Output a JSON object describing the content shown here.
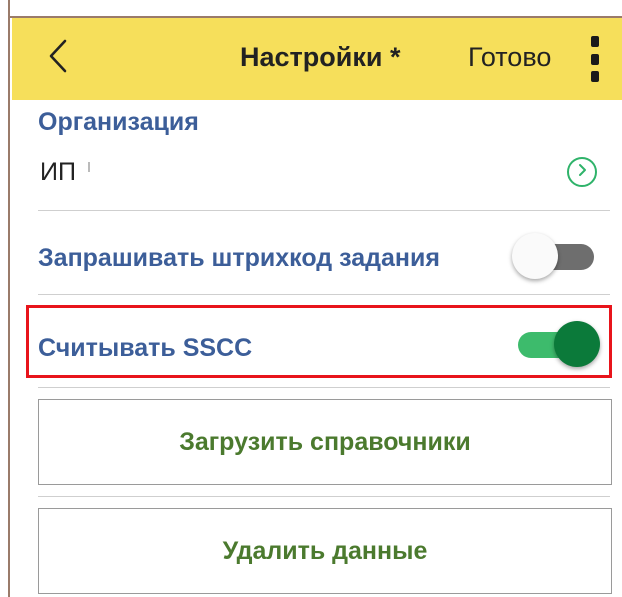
{
  "header": {
    "back_icon": "chevron-left-icon",
    "title": "Настройки *",
    "done_label": "Готово",
    "menu_icon": "more-vertical-icon",
    "background_color": "#f6df5b"
  },
  "organization": {
    "label": "Организация",
    "value": "ИП",
    "nav_icon": "chevron-right-circle-icon"
  },
  "settings": {
    "request_task_barcode": {
      "label": "Запрашивать штрихкод задания",
      "enabled": false
    },
    "read_sscc": {
      "label": "Считывать SSCC",
      "enabled": true
    }
  },
  "actions": {
    "load_directories_label": "Загрузить справочники",
    "delete_data_label": "Удалить данные"
  },
  "colors": {
    "label_blue": "#3c5e99",
    "button_text_green": "#4b7a2e",
    "toggle_on": "#0b7a3a",
    "toggle_on_track": "#3dbb6c",
    "toggle_off_track": "#6e6e6e",
    "highlight_red": "#e8141b"
  }
}
